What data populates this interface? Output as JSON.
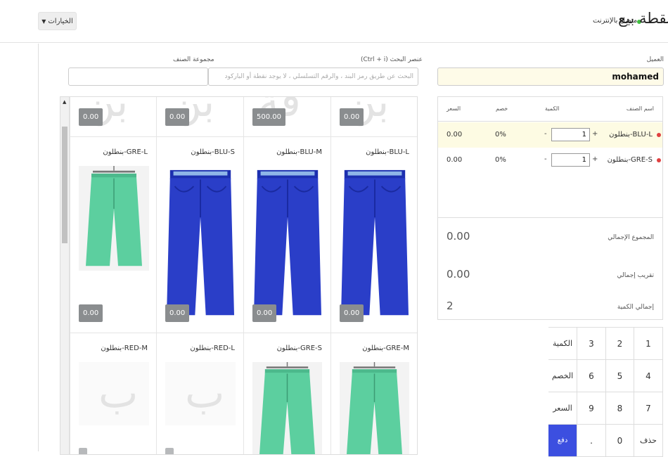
{
  "header": {
    "title": "نقطة بيع",
    "status": "متصل بالإنترنت",
    "options_label": "الخيارات"
  },
  "customer": {
    "label": "العميل",
    "value": "mohamed"
  },
  "search": {
    "label": "عنصر البحث (Ctrl + i)",
    "placeholder": "البحث عن طريق رمز البند ، والرقم التسلسلي ، لا يوجد نقطة أو الباركود"
  },
  "item_group": {
    "label": "مجموعة الصنف",
    "value": ""
  },
  "cart": {
    "headers": {
      "item": "اسم الصنف",
      "qty": "الكمية",
      "discount": "خصم",
      "price": "السعر"
    },
    "rows": [
      {
        "name": "بنطلون-BLU-L",
        "qty": "1",
        "discount": "0%",
        "price": "0.00"
      },
      {
        "name": "بنطلون-GRE-S",
        "qty": "1",
        "discount": "0%",
        "price": "0.00"
      }
    ],
    "totals": {
      "grand_total_label": "المجموع الإجمالي",
      "grand_total": "0.00",
      "rounded_label": "تقريب إجمالي",
      "rounded": "0.00",
      "qty_label": "إجمالي الكمية",
      "qty": "2"
    }
  },
  "keypad": {
    "keys": [
      "1",
      "2",
      "3",
      "الكمية",
      "4",
      "5",
      "6",
      "الخصم",
      "7",
      "8",
      "9",
      "السعر",
      "حذف",
      "0",
      ".",
      "دفع"
    ]
  },
  "products": {
    "top_partial": [
      {
        "price": "0.00",
        "letter": "بن"
      },
      {
        "price": "500.00",
        "letter": "قة"
      },
      {
        "price": "0.00",
        "letter": "بن"
      },
      {
        "price": "0.00",
        "letter": "بن"
      }
    ],
    "row2": [
      {
        "name": "بنطلون-BLU-L",
        "price": "0.00",
        "color": "blue"
      },
      {
        "name": "بنطلون-BLU-M",
        "price": "0.00",
        "color": "blue"
      },
      {
        "name": "بنطلون-BLU-S",
        "price": "0.00",
        "color": "blue"
      },
      {
        "name": "بنطلون-GRE-L",
        "price": "0.00",
        "color": "green"
      }
    ],
    "row3": [
      {
        "name": "بنطلون-GRE-M",
        "color": "green"
      },
      {
        "name": "بنطلون-GRE-S",
        "color": "green"
      },
      {
        "name": "بنطلون-RED-L",
        "letter": "ب"
      },
      {
        "name": "بنطلون-RED-M",
        "letter": "ب"
      }
    ]
  },
  "colors": {
    "pay": "#3c4fe0",
    "selected_row": "#fdfbe3",
    "online": "#3fbf3f"
  }
}
